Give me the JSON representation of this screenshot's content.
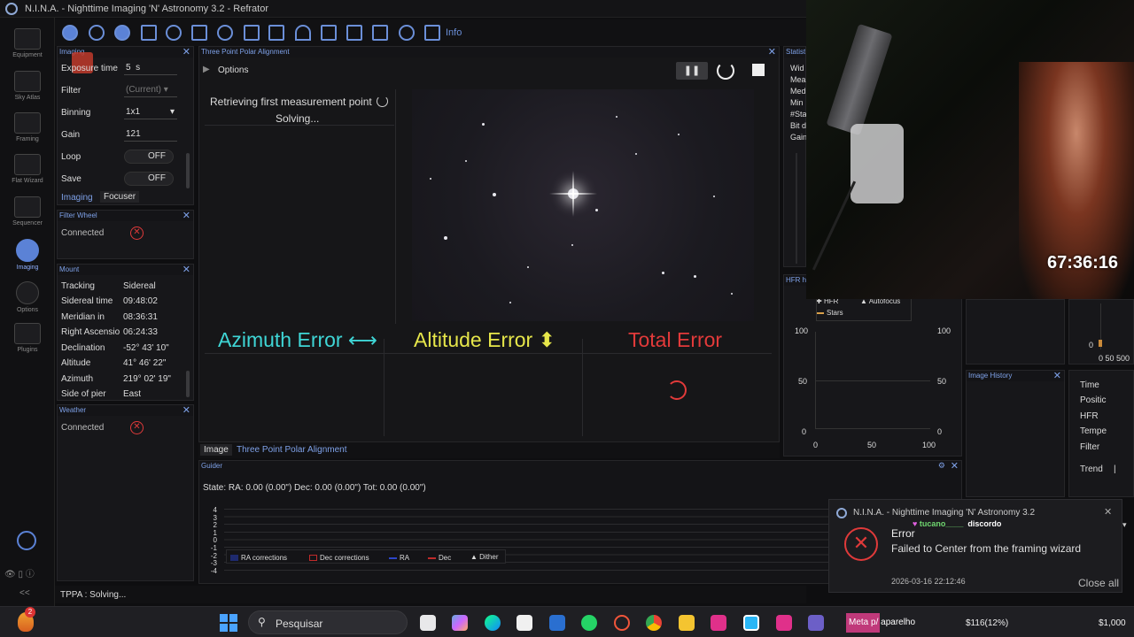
{
  "app": {
    "title": "N.I.N.A. - Nighttime Imaging 'N' Astronomy 3.2",
    "profile": "Refrator"
  },
  "sidebar": {
    "items": [
      {
        "label": "Equipment"
      },
      {
        "label": "Sky Atlas"
      },
      {
        "label": "Framing"
      },
      {
        "label": "Flat Wizard"
      },
      {
        "label": "Sequencer"
      },
      {
        "label": "Imaging"
      },
      {
        "label": "Options"
      },
      {
        "label": "Plugins"
      }
    ],
    "collapse": "<<"
  },
  "toolbar": {
    "info_label": "Info"
  },
  "imaging_panel": {
    "title": "Imaging",
    "exposure_label": "Exposure time",
    "exposure_value": "5",
    "exposure_unit": "s",
    "filter_label": "Filter",
    "filter_value": "(Current)",
    "binning_label": "Binning",
    "binning_value": "1x1",
    "gain_label": "Gain",
    "gain_value": "121",
    "loop_label": "Loop",
    "loop_value": "OFF",
    "save_label": "Save",
    "save_value": "OFF",
    "tabs": [
      "Imaging",
      "Focuser"
    ]
  },
  "filter_wheel": {
    "title": "Filter Wheel",
    "status": "Connected"
  },
  "mount": {
    "title": "Mount",
    "rows": [
      {
        "label": "Tracking",
        "value": "Sidereal"
      },
      {
        "label": "Sidereal time",
        "value": "09:48:02"
      },
      {
        "label": "Meridian in",
        "value": "08:36:31"
      },
      {
        "label": "Right Ascensio",
        "value": "06:24:33"
      },
      {
        "label": "Declination",
        "value": "-52° 43' 10\""
      },
      {
        "label": "Altitude",
        "value": "41° 46' 22\""
      },
      {
        "label": "Azimuth",
        "value": "219° 02' 19\""
      },
      {
        "label": "Side of pier",
        "value": "East"
      }
    ]
  },
  "weather": {
    "title": "Weather",
    "status": "Connected"
  },
  "tppa": {
    "title": "Three Point Polar Alignment",
    "options_label": "Options",
    "status_line1": "Retrieving first measurement point",
    "status_line2": "Solving...",
    "azimuth_label": "Azimuth Error ⟷",
    "altitude_label": "Altitude Error ⬍",
    "total_label": "Total Error",
    "colors": {
      "azimuth": "#3fd6d6",
      "altitude": "#e6e64a",
      "total": "#e23a3a"
    }
  },
  "center_tabs": [
    "Image",
    "Three Point Polar Alignment"
  ],
  "statistics": {
    "title": "Statistics",
    "rows": [
      "Wid",
      "Mea",
      "Med",
      "Min",
      "#Sta",
      "Bit d",
      "Gain"
    ]
  },
  "hfr_history": {
    "title": "HFR h",
    "legend": [
      "HFR",
      "Autofocus",
      "Stars"
    ],
    "y_ticks": [
      "100",
      "50",
      "0"
    ],
    "x_ticks": [
      "0",
      "50",
      "100"
    ]
  },
  "right_small_chart": {
    "y_tick": "0",
    "x_ticks": "0 50 500"
  },
  "image_history": {
    "title": "Image History"
  },
  "image_info": {
    "rows": [
      "Time",
      "Positic",
      "HFR",
      "Tempe",
      "Filter",
      "Trend"
    ],
    "trend_value": "|"
  },
  "guider": {
    "title": "Guider",
    "state_line": "State:  RA: 0.00 (0.00\")  Dec: 0.00 (0.00\")  Tot: 0.00 (0.00\")",
    "y_ticks": [
      "4",
      "3",
      "2",
      "1",
      "0",
      "-1",
      "-2",
      "-3",
      "-4"
    ],
    "legend": [
      "RA corrections",
      "Dec corrections",
      "RA",
      "Dec",
      "Dither"
    ]
  },
  "statusbar": {
    "text": "TPPA :  Solving..."
  },
  "webcam": {
    "timer": "67:36:16"
  },
  "toast": {
    "app": "N.I.N.A. - Nighttime Imaging 'N' Astronomy 3.2",
    "chat_user": "tucano____",
    "chat_msg": "discordo",
    "heading": "Error",
    "message": "Failed to Center from the framing wizard",
    "timestamp": "2026-03-16 22:12:46",
    "close_all": "Close all"
  },
  "taskbar": {
    "search_placeholder": "Pesquisar",
    "badge_count": "2",
    "overlay_text": "Meta p/ aparelho",
    "stock1": "$116(12%)",
    "stock2": "$1,000"
  }
}
